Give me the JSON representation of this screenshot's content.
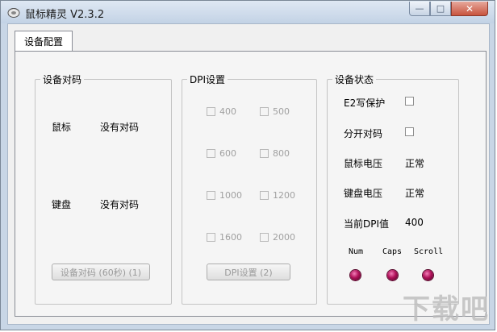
{
  "window": {
    "title": "鼠标精灵 V2.3.2",
    "buttons": {
      "minimize": "—",
      "maximize": "□",
      "close": "✕"
    }
  },
  "tabs": [
    {
      "label": "设备配置",
      "active": true
    }
  ],
  "pairing_group": {
    "title": "设备对码",
    "rows": [
      {
        "device": "鼠标",
        "status": "没有对码"
      },
      {
        "device": "键盘",
        "status": "没有对码"
      }
    ],
    "pair_button": "设备对码 (60秒) (1)"
  },
  "dpi_group": {
    "title": "DPI设置",
    "options": [
      "400",
      "500",
      "600",
      "800",
      "1000",
      "1200",
      "1600",
      "2000"
    ],
    "set_button": "DPI设置 (2)"
  },
  "status_group": {
    "title": "设备状态",
    "e2_label": "E2写保护",
    "split_label": "分开对码",
    "mouse_voltage_label": "鼠标电压",
    "mouse_voltage_value": "正常",
    "keyboard_voltage_label": "键盘电压",
    "keyboard_voltage_value": "正常",
    "current_dpi_label": "当前DPI值",
    "current_dpi_value": "400",
    "indicators": [
      "Num",
      "Caps",
      "Scroll"
    ],
    "indicator_color": "#b0125a"
  },
  "watermark": "下载吧"
}
